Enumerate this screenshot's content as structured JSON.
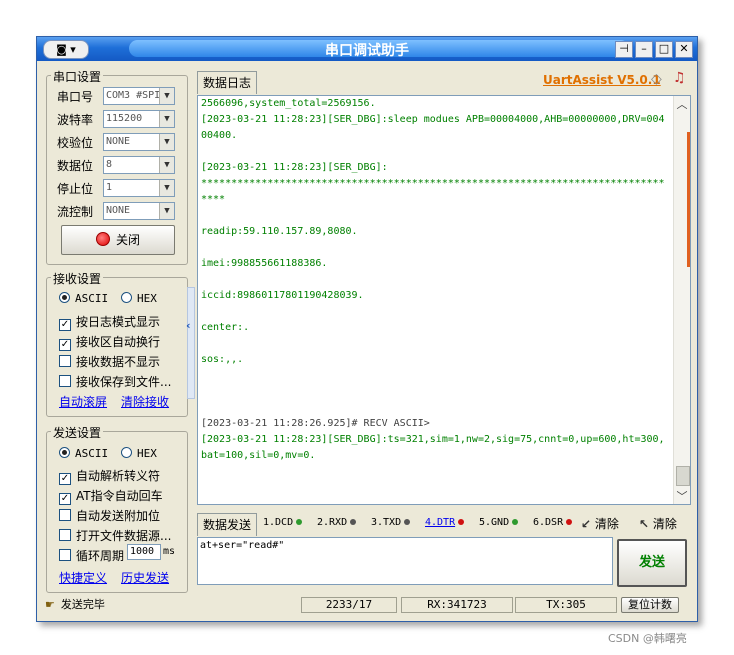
{
  "window": {
    "title": "串口调试助手",
    "sysmenu": "◙ ▾",
    "pin": "⊣",
    "min": "–",
    "max": "□",
    "close": "✕"
  },
  "serial_settings": {
    "title": "串口设置",
    "rows": [
      {
        "label": "串口号",
        "value": "COM3 #SPI"
      },
      {
        "label": "波特率",
        "value": "115200"
      },
      {
        "label": "校验位",
        "value": "NONE"
      },
      {
        "label": "数据位",
        "value": "8"
      },
      {
        "label": "停止位",
        "value": "1"
      },
      {
        "label": "流控制",
        "value": "NONE"
      }
    ],
    "close_button": "关闭"
  },
  "receive_settings": {
    "title": "接收设置",
    "radio_ascii": "ASCII",
    "radio_hex": "HEX",
    "checks": [
      {
        "label": "按日志模式显示",
        "checked": true
      },
      {
        "label": "接收区自动换行",
        "checked": true
      },
      {
        "label": "接收数据不显示",
        "checked": false
      },
      {
        "label": "接收保存到文件...",
        "checked": false
      }
    ],
    "link_autoscroll": "自动滚屏",
    "link_clear": "清除接收"
  },
  "send_settings": {
    "title": "发送设置",
    "radio_ascii": "ASCII",
    "radio_hex": "HEX",
    "checks": [
      {
        "label": "自动解析转义符",
        "checked": true
      },
      {
        "label": "AT指令自动回车",
        "checked": true
      },
      {
        "label": "自动发送附加位",
        "checked": false
      },
      {
        "label": "打开文件数据源...",
        "checked": false
      },
      {
        "label": "循环周期",
        "checked": false
      }
    ],
    "period_value": "1000",
    "period_unit": "ms",
    "link_shortcut": "快捷定义",
    "link_history": "历史发送"
  },
  "log": {
    "tab": "数据日志",
    "brand": "UartAssist V5.0.1",
    "lines": [
      {
        "text": "2566096,system_total=2569156.",
        "color": "#008000"
      },
      {
        "text": "[2023-03-21 11:28:23][SER_DBG]:sleep modues APB=00004000,AHB=00000000,DRV=00400400.",
        "color": "#008000"
      },
      {
        "text": "",
        "color": "#008000"
      },
      {
        "text": "[2023-03-21 11:28:23][SER_DBG]:",
        "color": "#008000"
      },
      {
        "text": "*********************************************************************************",
        "color": "#008000"
      },
      {
        "text": "",
        "color": "#008000"
      },
      {
        "text": "readip:59.110.157.89,8080.",
        "color": "#008000"
      },
      {
        "text": "",
        "color": "#008000"
      },
      {
        "text": "imei:998855661188386.",
        "color": "#008000"
      },
      {
        "text": "",
        "color": "#008000"
      },
      {
        "text": "iccid:89860117801190428039.",
        "color": "#008000"
      },
      {
        "text": "",
        "color": "#008000"
      },
      {
        "text": "center:.",
        "color": "#008000"
      },
      {
        "text": "",
        "color": "#008000"
      },
      {
        "text": "sos:,,.",
        "color": "#008000"
      },
      {
        "text": "",
        "color": "#008000"
      },
      {
        "text": "",
        "color": "#008000"
      },
      {
        "text": "",
        "color": "#008000"
      },
      {
        "text": "[2023-03-21 11:28:26.925]# RECV ASCII>",
        "color": "#404040"
      },
      {
        "text": "[2023-03-21 11:28:23][SER_DBG]:ts=321,sim=1,nw=2,sig=75,cnnt=0,up=600,ht=300,bat=100,sil=0,mv=0.",
        "color": "#008000"
      }
    ]
  },
  "send": {
    "tab": "数据发送",
    "signals": [
      {
        "label": "1.DCD",
        "led": "#2e9a2e"
      },
      {
        "label": "2.RXD",
        "led": "#555555"
      },
      {
        "label": "3.TXD",
        "led": "#555555"
      },
      {
        "label": "4.DTR",
        "led": "#d01010",
        "link": true
      },
      {
        "label": "5.GND",
        "led": "#2e9a2e"
      },
      {
        "label": "6.DSR",
        "led": "#d01010"
      }
    ],
    "clear1": "清除",
    "clear2": "清除",
    "input_value": "at+ser=\"read#\"",
    "send_button": "发送"
  },
  "status": {
    "message": "发送完毕",
    "counter": "2233/17",
    "rx": "RX:341723",
    "tx": "TX:305",
    "reset": "复位计数"
  },
  "watermark": "CSDN @韩曙亮"
}
